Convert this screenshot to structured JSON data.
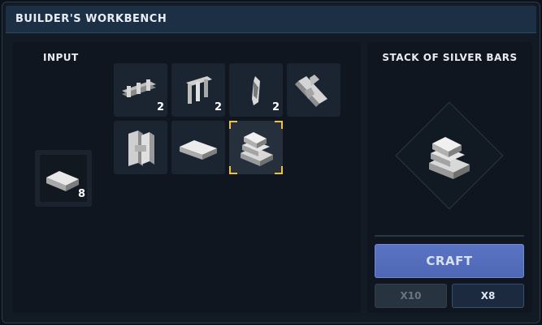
{
  "window": {
    "title": "BUILDER'S WORKBENCH"
  },
  "input": {
    "label": "INPUT",
    "item": {
      "icon": "silver-bar-icon",
      "count": "8"
    }
  },
  "recipes": [
    {
      "icon": "silver-rail-icon",
      "count": "2"
    },
    {
      "icon": "silver-fence-icon",
      "count": "2"
    },
    {
      "icon": "silver-chain-link-icon",
      "count": "2"
    },
    {
      "icon": "silver-beams-icon",
      "count": ""
    },
    {
      "icon": "silver-pillars-icon",
      "count": ""
    },
    {
      "icon": "silver-bar-icon",
      "count": ""
    },
    {
      "icon": "silver-bar-stack-icon",
      "count": "",
      "selected": true
    }
  ],
  "result": {
    "title": "STACK OF SILVER BARS",
    "icon": "silver-bar-stack-icon"
  },
  "actions": {
    "craft_label": "CRAFT",
    "qty_options": [
      {
        "label": "X10",
        "enabled": false
      },
      {
        "label": "X8",
        "enabled": true
      }
    ]
  },
  "colors": {
    "selection": "#f0c33c",
    "craft_button": "#5a74c4",
    "titlebar": "#1d2f45"
  }
}
